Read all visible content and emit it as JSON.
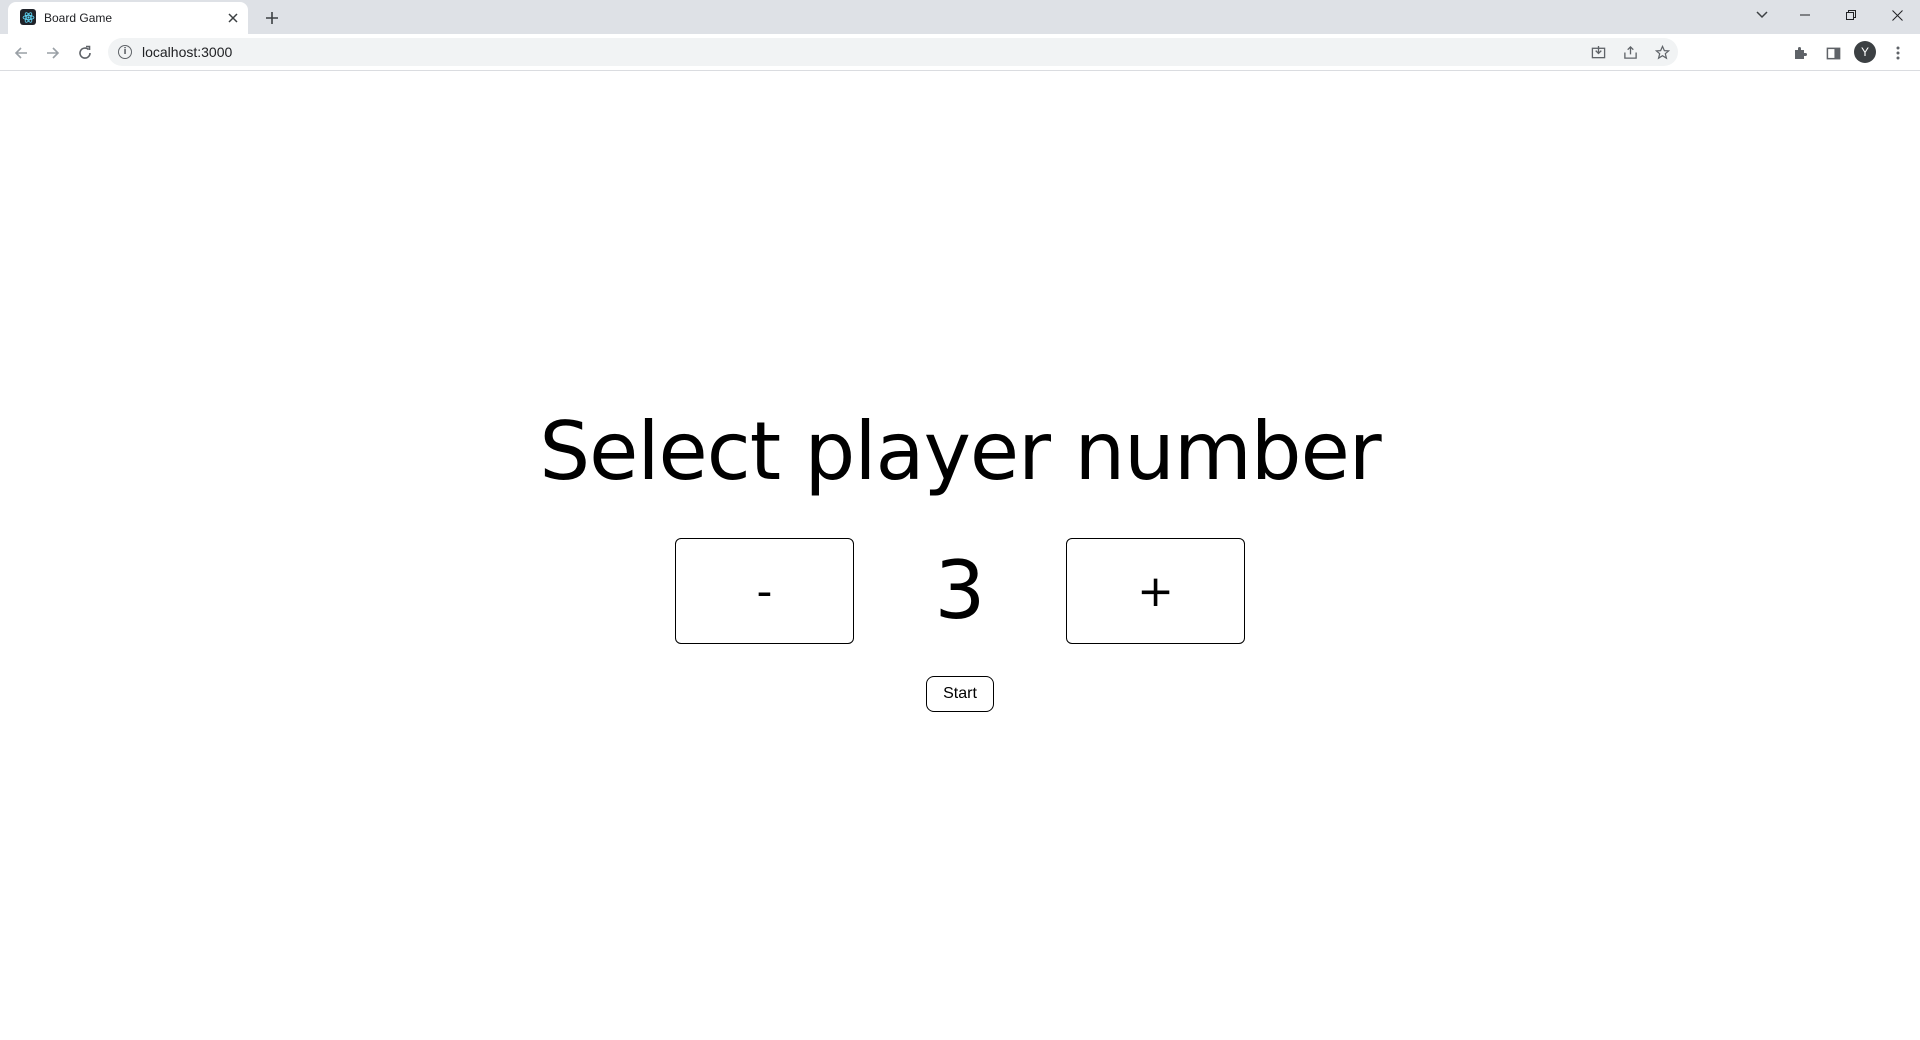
{
  "browser": {
    "tab_title": "Board Game",
    "url": "localhost:3000",
    "profile_initial": "Y",
    "icons": [
      "react-favicon-icon",
      "close-icon",
      "plus-icon",
      "chevron-down-icon",
      "minimize-icon",
      "restore-icon",
      "window-close-icon",
      "back-arrow-icon",
      "forward-arrow-icon",
      "reload-icon",
      "info-icon",
      "install-icon",
      "share-icon",
      "star-icon",
      "puzzle-icon",
      "side-panel-icon",
      "kebab-menu-icon"
    ]
  },
  "page": {
    "title": "Select player number",
    "decrement_label": "-",
    "increment_label": "+",
    "player_count": "3",
    "start_label": "Start"
  }
}
